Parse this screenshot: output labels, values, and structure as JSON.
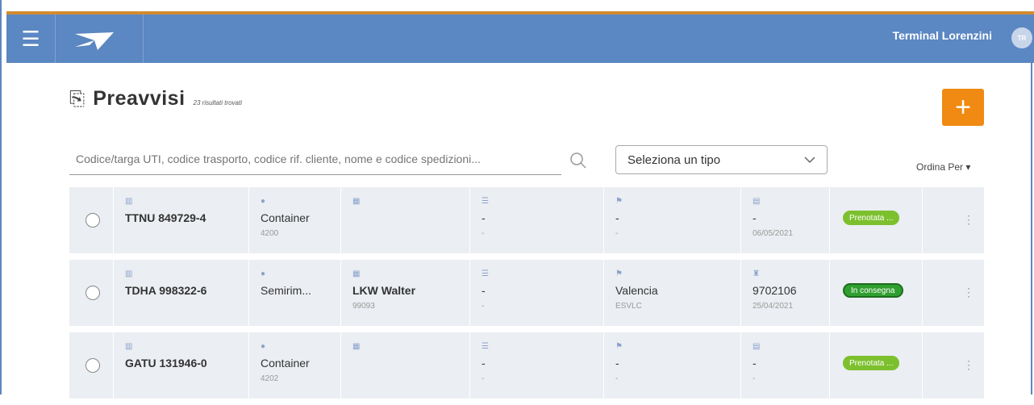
{
  "header": {
    "menu_icon": "hamburger-icon",
    "logo_icon": "plane-icon",
    "terminal_name": "Terminal Lorenzini",
    "avatar_initials": "TR",
    "accent_color": "#d28b2f",
    "bar_color": "#5b87c2"
  },
  "page": {
    "title": "Preavvisi",
    "title_icon": "document-icon",
    "results_count": "23 risultati trovati",
    "add_icon": "+",
    "add_color": "#f08a12"
  },
  "filters": {
    "search_placeholder": "Codice/targa UTI, codice trasporto, codice rif. cliente, nome e codice spedizioni...",
    "type_select": "Seleziona un tipo",
    "sort_label": "Ordina Per ▾"
  },
  "rows": [
    {
      "uti_icon": "uti-icon",
      "uti": "TTNU 849729-4",
      "type_icon": "info-icon",
      "type": "Container",
      "type_code": "4200",
      "company_icon": "building-icon",
      "company": "",
      "company_code": "",
      "filter_icon": "filter-icon",
      "filter": "-",
      "filter_sub": "-",
      "flag_icon": "flag-icon",
      "destination": "-",
      "destination_code": "-",
      "date_icon": "calendar-icon",
      "ref": "-",
      "date": "06/05/2021",
      "status": "Prenotata ...",
      "status_style": "light"
    },
    {
      "uti_icon": "uti-icon",
      "uti": "TDHA 998322-6",
      "type_icon": "info-icon",
      "type": "Semirim...",
      "type_code": "",
      "company_icon": "building-icon",
      "company": "LKW Walter",
      "company_code": "99093",
      "filter_icon": "filter-icon",
      "filter": "-",
      "filter_sub": "-",
      "flag_icon": "flag-icon",
      "destination": "Valencia",
      "destination_code": "ESVLC",
      "date_icon": "person-icon",
      "ref": "9702106",
      "date": "25/04/2021",
      "status": "In consegna",
      "status_style": "dark"
    },
    {
      "uti_icon": "uti-icon",
      "uti": "GATU 131946-0",
      "type_icon": "info-icon",
      "type": "Container",
      "type_code": "4202",
      "company_icon": "building-icon",
      "company": "",
      "company_code": "",
      "filter_icon": "filter-icon",
      "filter": "-",
      "filter_sub": "-",
      "flag_icon": "flag-icon",
      "destination": "-",
      "destination_code": "-",
      "date_icon": "calendar-icon",
      "ref": "-",
      "date": "-",
      "status": "Prenotata ...",
      "status_style": "light"
    }
  ]
}
